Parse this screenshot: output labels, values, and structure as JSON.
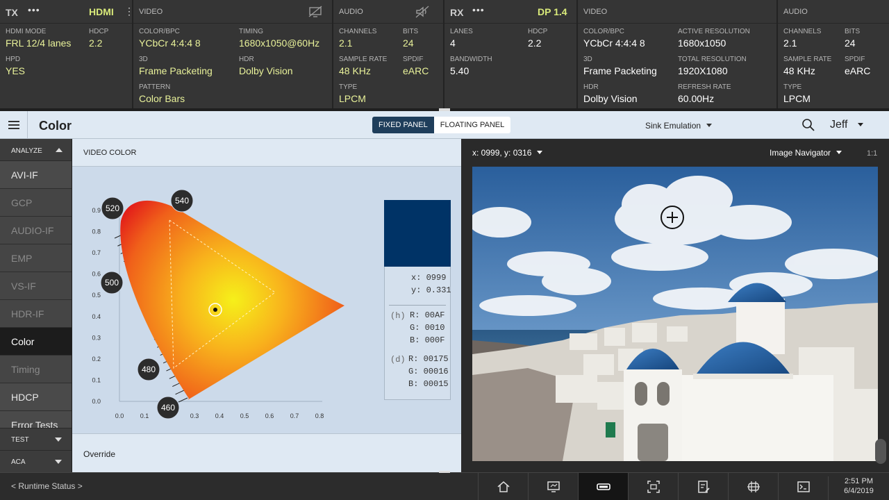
{
  "tx": {
    "label": "TX",
    "port": "HDMI",
    "hdmi_mode_label": "HDMI MODE",
    "hdmi_mode": "FRL 12/4 lanes",
    "hdcp_label": "HDCP",
    "hdcp": "2.2",
    "hpd_label": "HPD",
    "hpd": "YES",
    "video": {
      "title": "VIDEO",
      "color_bpc_label": "COLOR/BPC",
      "color_bpc": "YCbCr  4:4:4  8",
      "timing_label": "TIMING",
      "timing": "1680x1050@60Hz",
      "three_d_label": "3D",
      "three_d": "Frame Packeting",
      "hdr_label": "HDR",
      "hdr": "Dolby Vision",
      "pattern_label": "PATTERN",
      "pattern": "Color Bars"
    },
    "audio": {
      "title": "AUDIO",
      "channels_label": "CHANNELS",
      "channels": "2.1",
      "bits_label": "BITS",
      "bits": "24",
      "sample_rate_label": "SAMPLE RATE",
      "sample_rate": "48 KHz",
      "spdif_label": "SPDIF",
      "spdif": "eARC",
      "type_label": "TYPE",
      "type": "LPCM"
    }
  },
  "rx": {
    "label": "RX",
    "port": "DP 1.4",
    "lanes_label": "LANES",
    "lanes": "4",
    "hdcp_label": "HDCP",
    "hdcp": "2.2",
    "bandwidth_label": "BANDWIDTH",
    "bandwidth": "5.40",
    "video": {
      "title": "VIDEO",
      "color_bpc_label": "COLOR/BPC",
      "color_bpc": "YCbCr  4:4:4  8",
      "active_res_label": "ACTIVE RESOLUTION",
      "active_res": "1680x1050",
      "three_d_label": "3D",
      "three_d": "Frame Packeting",
      "total_res_label": "TOTAL RESOLUTION",
      "total_res": "1920X1080",
      "hdr_label": "HDR",
      "hdr": "Dolby Vision",
      "refresh_label": "REFRESH RATE",
      "refresh": "60.00Hz"
    },
    "audio": {
      "title": "AUDIO",
      "channels_label": "CHANNELS",
      "channels": "2.1",
      "bits_label": "BITS",
      "bits": "24",
      "sample_rate_label": "SAMPLE RATE",
      "sample_rate": "48 KHz",
      "spdif_label": "SPDIF",
      "spdif": "eARC",
      "type_label": "TYPE",
      "type": "LPCM"
    }
  },
  "header": {
    "title": "Color",
    "fixed_panel": "FIXED PANEL",
    "floating_panel": "FLOATING PANEL",
    "sink_emulation": "Sink Emulation",
    "user": "Jeff"
  },
  "sidebar": {
    "analyze": "ANALYZE",
    "items": [
      {
        "label": "AVI-IF",
        "state": "normal"
      },
      {
        "label": "GCP",
        "state": "dim"
      },
      {
        "label": "AUDIO-IF",
        "state": "dim"
      },
      {
        "label": "EMP",
        "state": "dim"
      },
      {
        "label": "VS-IF",
        "state": "dim"
      },
      {
        "label": "HDR-IF",
        "state": "dim"
      },
      {
        "label": "Color",
        "state": "active"
      },
      {
        "label": "Timing",
        "state": "dim"
      },
      {
        "label": "HDCP",
        "state": "normal"
      },
      {
        "label": "Error Tests",
        "state": "normal"
      }
    ],
    "test": "TEST",
    "aca": "ACA"
  },
  "video_color": {
    "title": "VIDEO COLOR",
    "override": "Override",
    "swatch_color": "#003366",
    "x_label": "x:",
    "x": "0999",
    "y_label": "y:",
    "y": "0.331",
    "h_tag": "(h)",
    "h_r_label": "R:",
    "h_r": "00AF",
    "h_g_label": "G:",
    "h_g": "0010",
    "h_b_label": "B:",
    "h_b": "000F",
    "d_tag": "(d)",
    "d_r_label": "R:",
    "d_r": "00175",
    "d_g_label": "G:",
    "d_g": "00016",
    "d_b_label": "B:",
    "d_b": "00015"
  },
  "chart_data": {
    "type": "scatter",
    "title": "",
    "xlabel": "",
    "ylabel": "",
    "xlim": [
      0.0,
      0.8
    ],
    "ylim": [
      0.0,
      0.9
    ],
    "x_ticks": [
      "0.0",
      "0.1",
      "0.3",
      "0.4",
      "0.5",
      "0.6",
      "0.7",
      "0.8"
    ],
    "y_ticks": [
      "0.0",
      "0.1",
      "0.2",
      "0.3",
      "0.4",
      "0.5",
      "0.6",
      "0.7",
      "0.8",
      "0.9"
    ],
    "wavelength_labels": [
      "520",
      "540",
      "500",
      "480",
      "460"
    ],
    "locus": [
      [
        0.01,
        0.01
      ],
      [
        0.18,
        0.02
      ],
      [
        0.25,
        0.05
      ],
      [
        0.4,
        0.22
      ],
      [
        0.58,
        0.38
      ],
      [
        0.71,
        0.3
      ]
    ],
    "marker": {
      "x": 0.31,
      "y": 0.331
    }
  },
  "viewer": {
    "coordinates": "x: 0999, y: 0316",
    "navigator": "Image Navigator",
    "zoom": "1:1"
  },
  "footer": {
    "runtime_status": "< Runtime Status >",
    "time": "2:51 PM",
    "date": "6/4/2019"
  },
  "colors": {
    "accent": "#d9ea7a",
    "panel_bg": "#ccdaea",
    "active_segment": "#1f3e5b"
  }
}
